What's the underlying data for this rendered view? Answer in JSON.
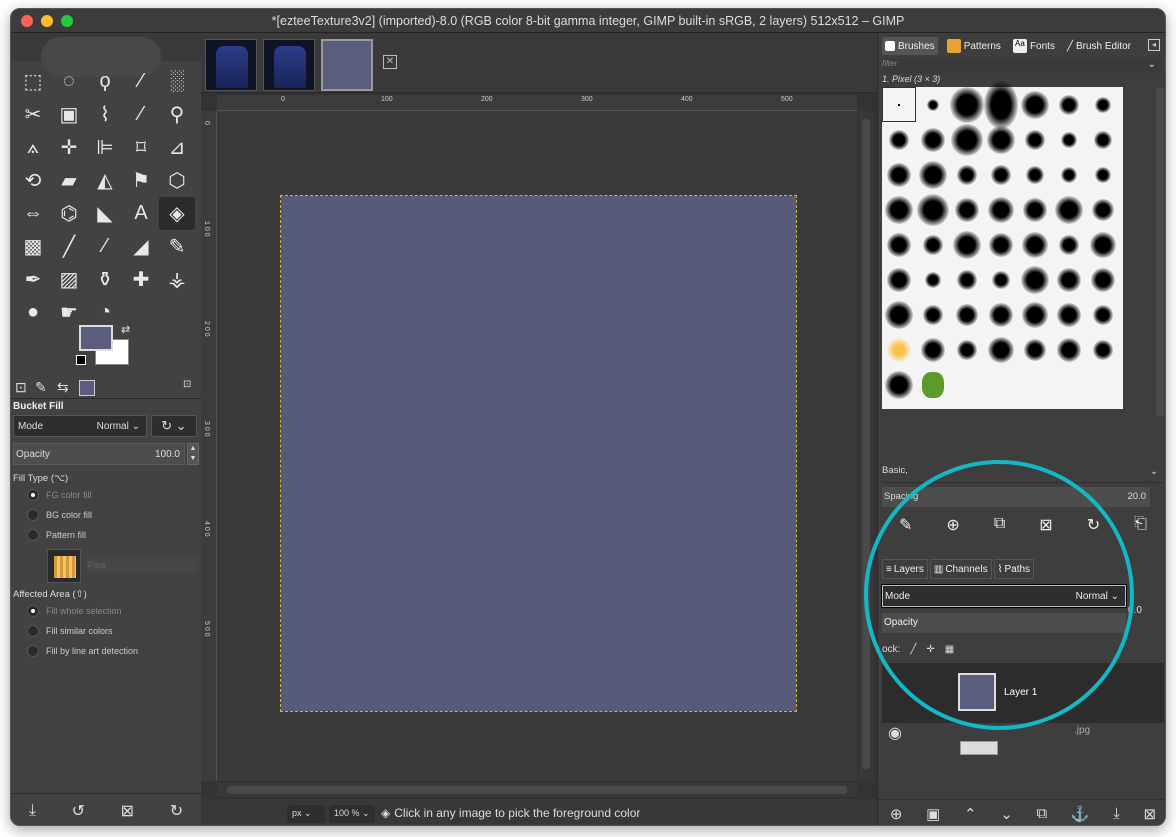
{
  "window": {
    "title": "*[ezteeTexture3v2] (imported)-8.0 (RGB color 8-bit gamma integer, GIMP built-in sRGB, 2 layers) 512x512 – GIMP"
  },
  "tool_options": {
    "title": "Bucket Fill",
    "mode_label": "Mode",
    "mode_value": "Normal",
    "opacity_label": "Opacity",
    "opacity_value": "100.0",
    "fill_type_label": "Fill Type  (⌥)",
    "fill_types": [
      "FG color fill",
      "BG color fill",
      "Pattern fill"
    ],
    "pattern_name": "Pine",
    "affected_area_label": "Affected Area  (⇧)",
    "affected_areas": [
      "Fill whole selection",
      "Fill similar colors",
      "Fill by line art detection"
    ]
  },
  "colors": {
    "foreground": "#5a5d7e",
    "background": "#ffffff",
    "accent_ring": "#14b8c4"
  },
  "ruler": {
    "h_ticks": [
      "0",
      "100",
      "200",
      "300",
      "400",
      "500"
    ],
    "v_ticks": [
      "0",
      "1\n0\n0",
      "2\n0\n0",
      "3\n0\n0",
      "4\n0\n0",
      "5\n0\n0"
    ]
  },
  "status": {
    "unit": "px",
    "zoom": "100 %",
    "message": "Click in any image to pick the foreground color"
  },
  "brushes_panel": {
    "tabs": [
      "Brushes",
      "Patterns",
      "Fonts",
      "Brush Editor"
    ],
    "filter_placeholder": "filter",
    "selected_brush": "1. Pixel (3 × 3)",
    "preset": "Basic,",
    "spacing_label": "Spacing",
    "spacing_value": "20.0"
  },
  "layers_panel": {
    "tabs": [
      "Layers",
      "Channels",
      "Paths"
    ],
    "mode_label": "Mode",
    "mode_value": "Normal",
    "opacity_label": "Opacity",
    "lock_label": "ock:",
    "layers": [
      "Layer 1"
    ],
    "second_layer_suffix": ".jpg",
    "side_value": "0.0"
  }
}
